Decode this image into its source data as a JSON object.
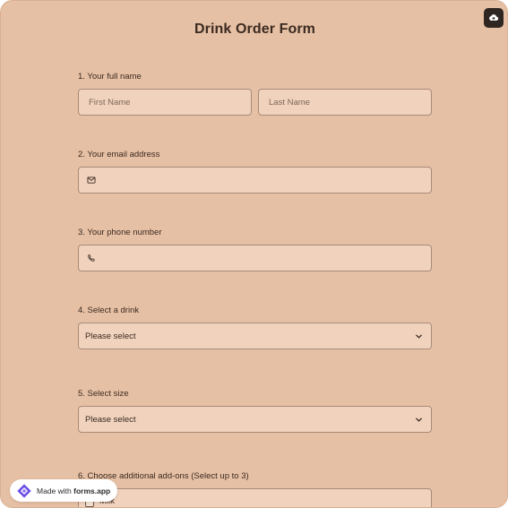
{
  "form": {
    "title": "Drink Order Form",
    "questions": [
      {
        "label": "1.  Your full name",
        "first_placeholder": "First Name",
        "last_placeholder": "Last Name"
      },
      {
        "label": "2. Your email address",
        "icon": "mail-icon"
      },
      {
        "label": "3. Your phone number",
        "icon": "phone-icon"
      },
      {
        "label": "4. Select a drink",
        "selected": "Please select"
      },
      {
        "label": "5. Select size",
        "selected": "Please select"
      },
      {
        "label": "6. Choose additional add-ons (Select up to 3)",
        "options": [
          "Milk"
        ]
      }
    ]
  },
  "header": {
    "cloud_button_icon": "cloud-upload-icon"
  },
  "badge": {
    "prefix": "Made with ",
    "brand": "forms.app",
    "logo_icon": "forms-app-logo-icon"
  },
  "colors": {
    "background": "#e6c0a4",
    "field_fill": "#f0d2bd",
    "field_border": "#a98b78",
    "text": "#3b2a21"
  }
}
